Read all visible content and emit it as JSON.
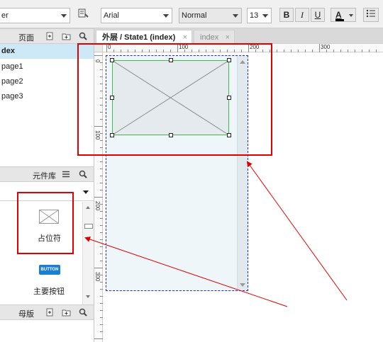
{
  "toolbar": {
    "style_select": "er",
    "font_family": "Arial",
    "font_style": "Normal",
    "font_size": "13",
    "bold": "B",
    "italic": "I",
    "underline": "U",
    "text_color": "A",
    "accent_color": "#d40000"
  },
  "pages_panel": {
    "title": "页面",
    "items": [
      {
        "label": "dex",
        "selected": true
      },
      {
        "label": "page1"
      },
      {
        "label": "page2"
      },
      {
        "label": "page3"
      }
    ]
  },
  "widgets_panel": {
    "title": "元件库",
    "items": [
      {
        "label": "占位符"
      },
      {
        "icon_text": "BUTTON",
        "label": "主要按钮"
      }
    ]
  },
  "masters_panel": {
    "title": "母版"
  },
  "tabs": [
    {
      "label": "外层 / State1 (index)",
      "active": true,
      "close": "×"
    },
    {
      "label": "index",
      "active": false,
      "close": "×"
    }
  ],
  "ruler": {
    "horizontal": [
      "0",
      "100",
      "200",
      "300"
    ],
    "vertical": [
      "0",
      "100",
      "200",
      "300"
    ]
  },
  "colors": {
    "selection_green": "#3fbf3f",
    "annotation_red": "#e00000",
    "dashed_blue": "#2a2acc",
    "placeholder_fill": "#e4eaee",
    "panel_fill": "#eef6fa"
  }
}
